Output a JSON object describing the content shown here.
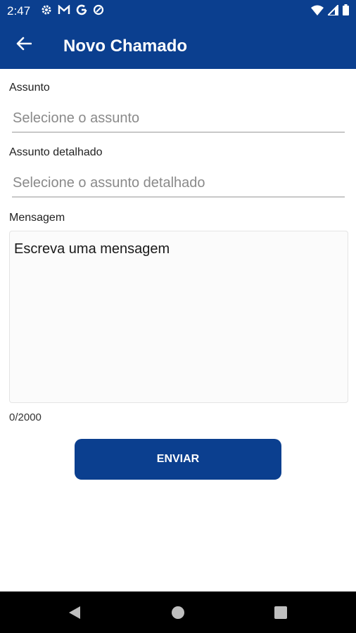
{
  "status_bar": {
    "time": "2:47",
    "icons_left": [
      "gear-icon",
      "gmail-icon",
      "google-icon",
      "data-saver-icon"
    ],
    "icons_right": [
      "wifi-icon",
      "signal-icon",
      "battery-icon"
    ]
  },
  "app_bar": {
    "title": "Novo Chamado",
    "back_icon": "arrow-left-icon",
    "color": "#0b3f8f"
  },
  "form": {
    "subject_label": "Assunto",
    "subject_placeholder": "Selecione o assunto",
    "detailed_subject_label": "Assunto detalhado",
    "detailed_subject_placeholder": "Selecione o assunto detalhado",
    "message_label": "Mensagem",
    "message_placeholder": "Escreva uma mensagem",
    "char_counter": "0/2000",
    "submit_label": "ENVIAR"
  },
  "nav_bar": {
    "buttons": [
      "back-triangle-icon",
      "home-circle-icon",
      "recents-square-icon"
    ]
  }
}
